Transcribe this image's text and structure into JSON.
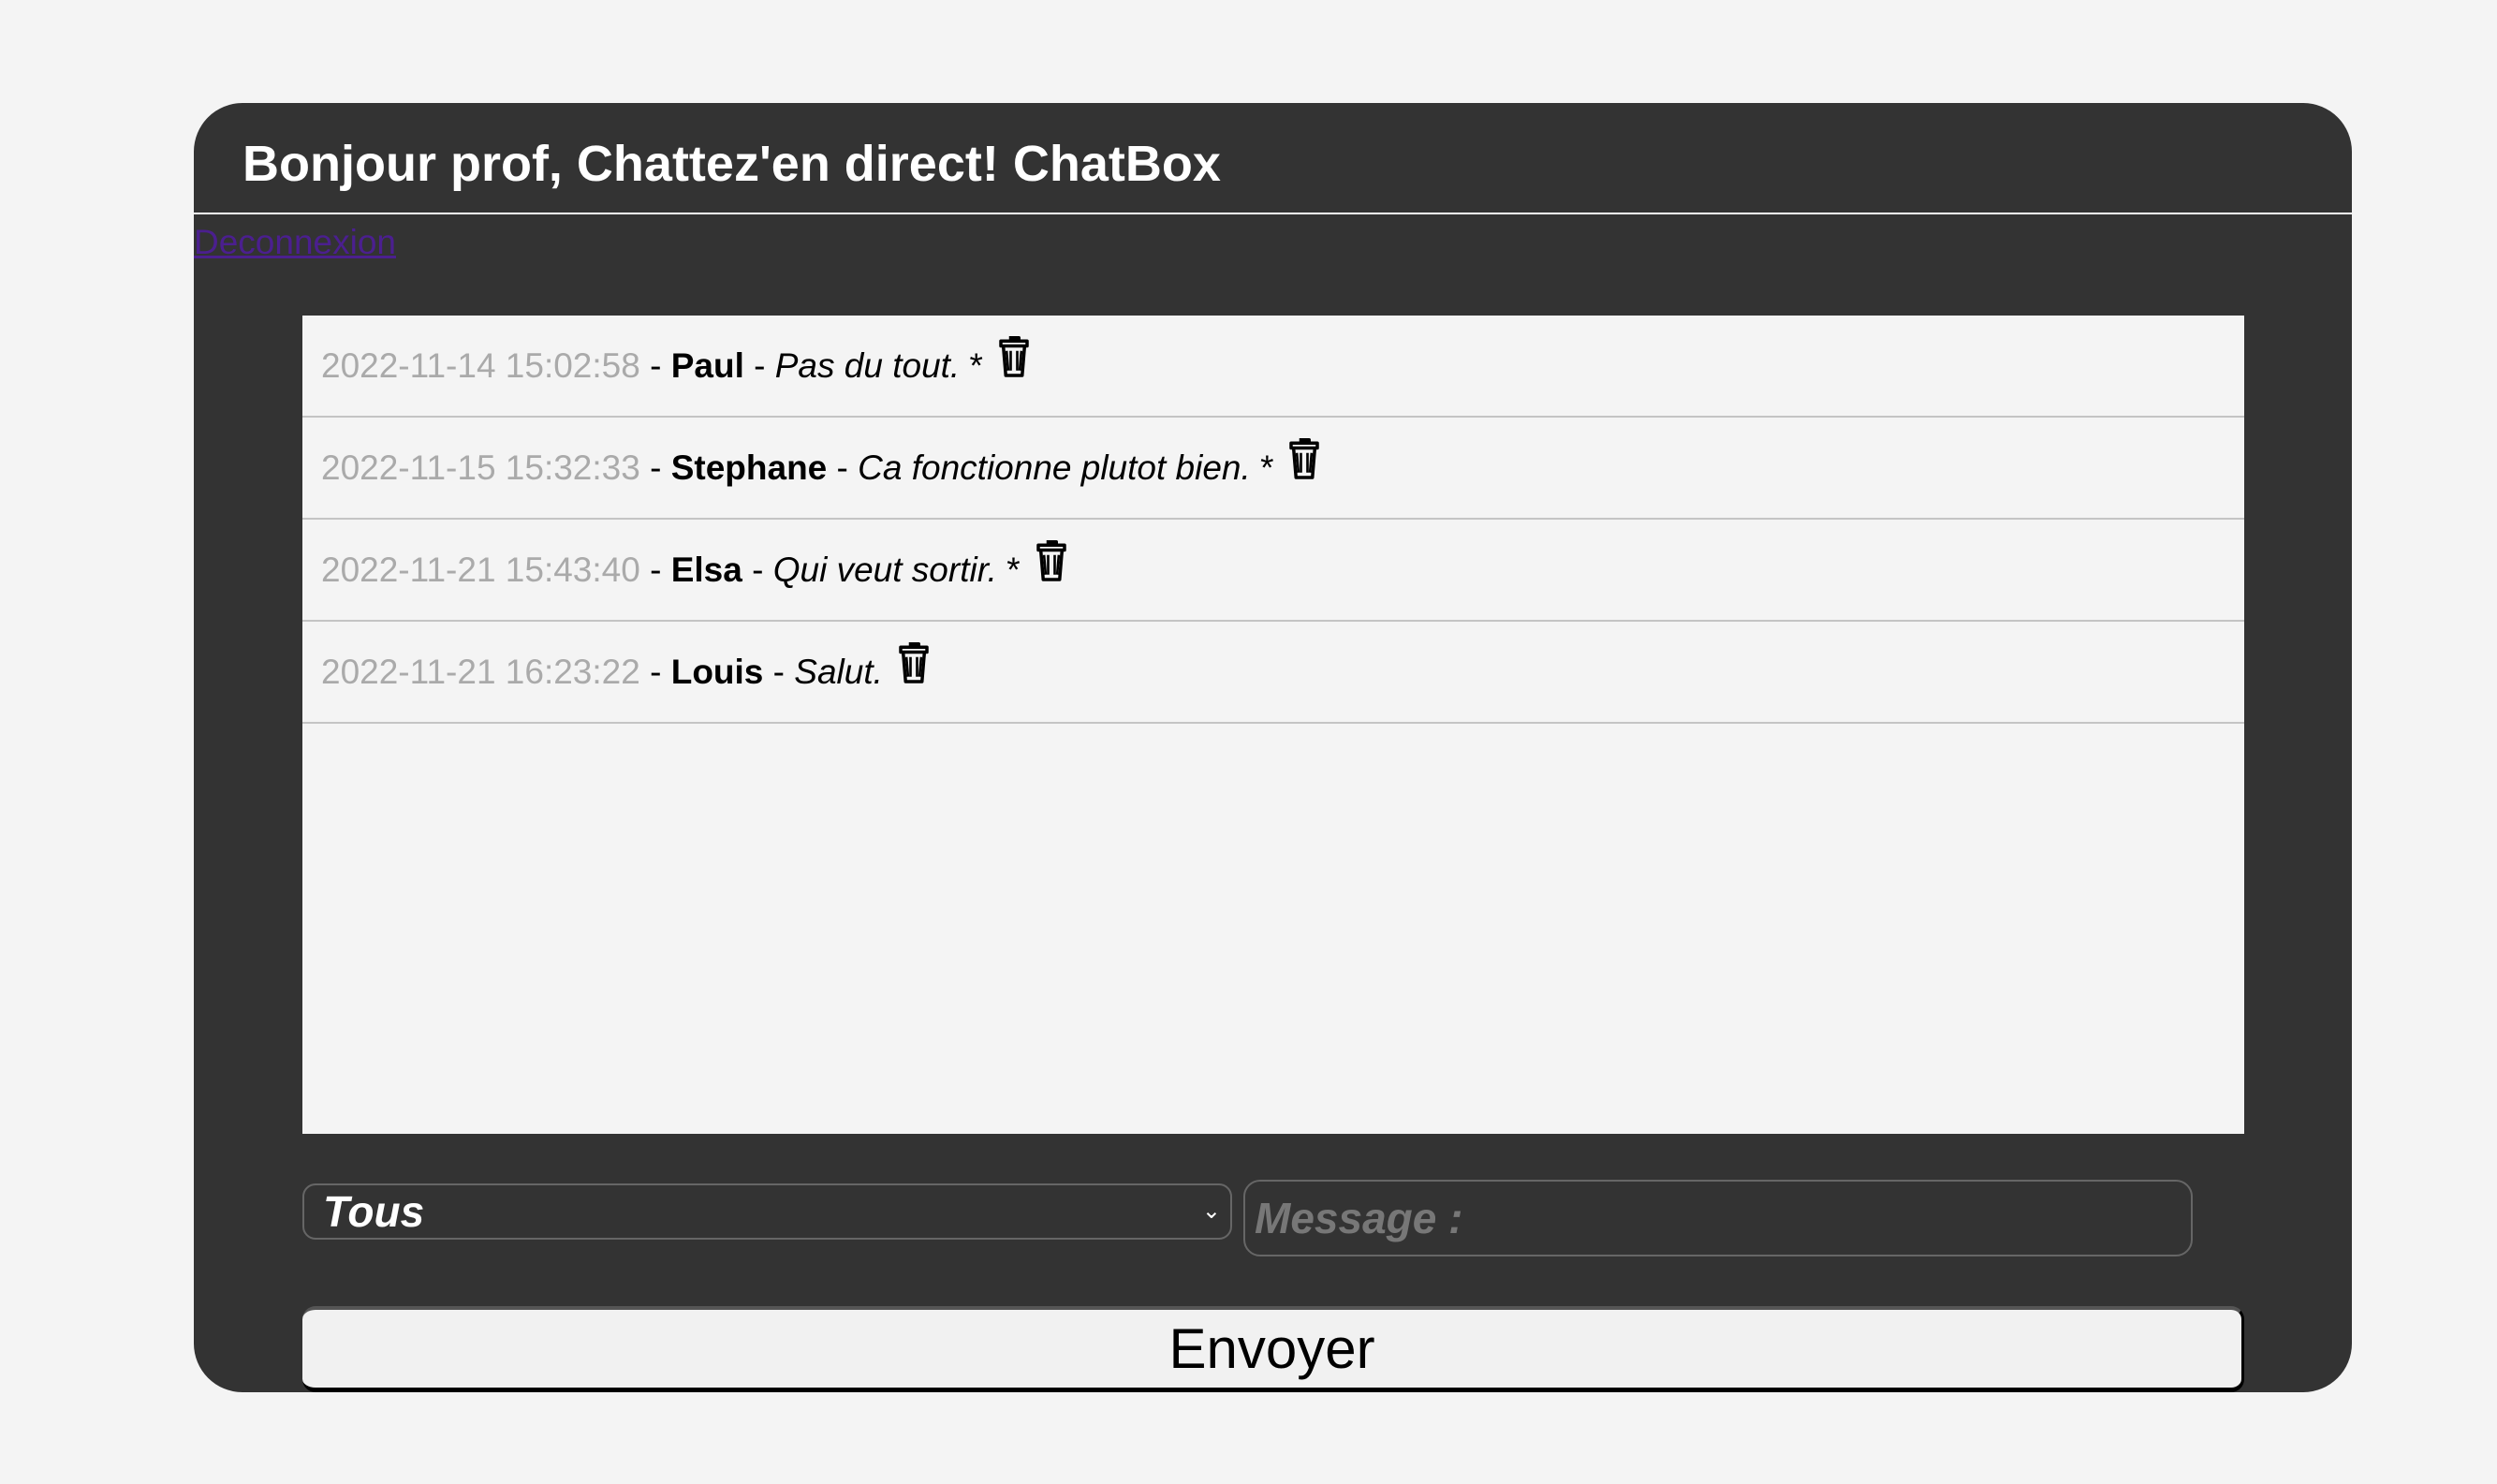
{
  "header": {
    "title": "Bonjour prof, Chattez'en direct! ChatBox",
    "logout_label": "Deconnexion"
  },
  "messages": [
    {
      "timestamp": "2022-11-14 15:02:58",
      "user": "Paul",
      "text": "Pas du tout.",
      "mark": " *"
    },
    {
      "timestamp": "2022-11-15 15:32:33",
      "user": "Stephane",
      "text": "Ca fonctionne plutot bien.",
      "mark": " *"
    },
    {
      "timestamp": "2022-11-21 15:43:40",
      "user": "Elsa",
      "text": "Qui veut sortir.",
      "mark": " *"
    },
    {
      "timestamp": "2022-11-21 16:23:22",
      "user": "Louis",
      "text": "Salut.",
      "mark": ""
    }
  ],
  "separator": " - ",
  "form": {
    "recipient_selected": "Tous",
    "message_placeholder": "Message :",
    "send_label": "Envoyer"
  },
  "icons": {
    "delete": "trash-icon",
    "dropdown": "chevron-down-icon"
  }
}
